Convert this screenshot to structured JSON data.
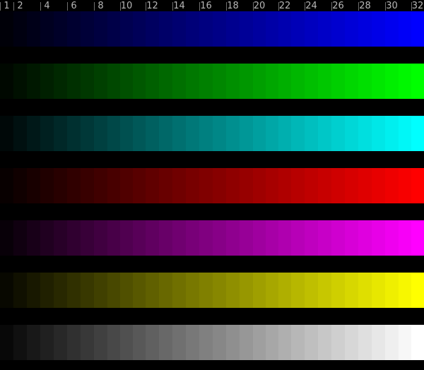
{
  "tick_labels": [
    "1",
    "2",
    "4",
    "6",
    "8",
    "10",
    "12",
    "14",
    "16",
    "18",
    "20",
    "22",
    "24",
    "26",
    "28",
    "30",
    "32"
  ],
  "tick_steps": [
    1,
    2,
    4,
    6,
    8,
    10,
    12,
    14,
    16,
    18,
    20,
    22,
    24,
    26,
    28,
    30,
    32
  ],
  "step_count": 32,
  "ramps": [
    {
      "name": "blue",
      "color": "#0000ff"
    },
    {
      "name": "green",
      "color": "#00ff00"
    },
    {
      "name": "cyan",
      "color": "#00ffff"
    },
    {
      "name": "red",
      "color": "#ff0000"
    },
    {
      "name": "magenta",
      "color": "#ff00ff"
    },
    {
      "name": "yellow",
      "color": "#ffff00"
    },
    {
      "name": "gray",
      "color": "#ffffff"
    }
  ],
  "colors": {
    "background": "#000000",
    "tick_text": "#b7b7b7",
    "tick_mark": "#6f6f6f"
  }
}
